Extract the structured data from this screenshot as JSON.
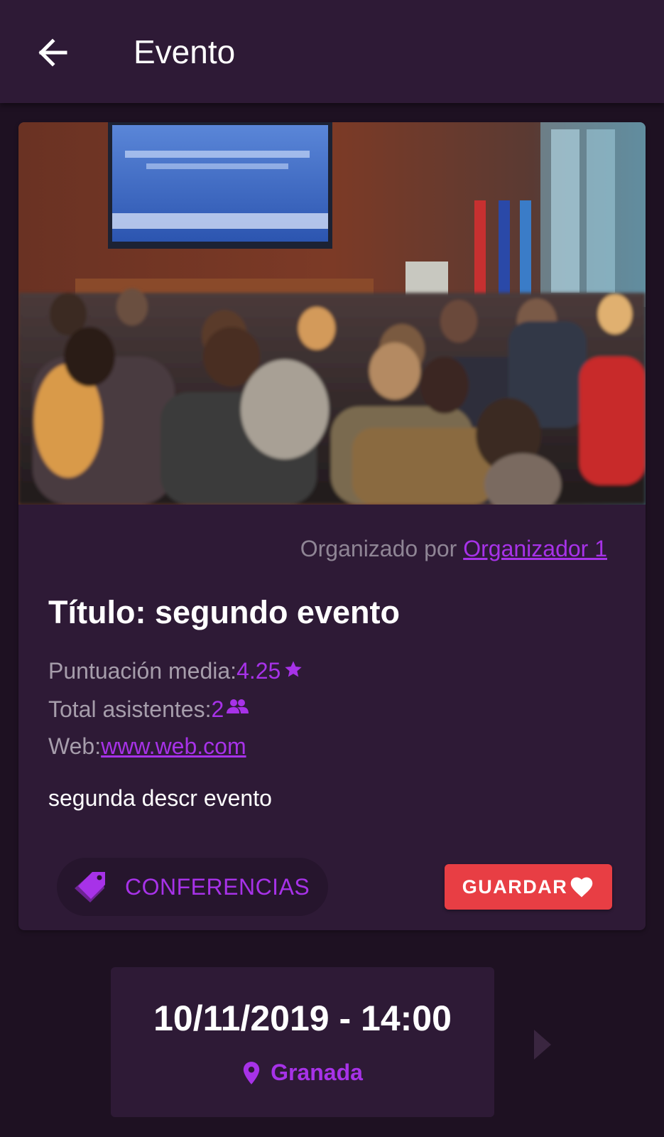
{
  "appbar": {
    "title": "Evento"
  },
  "event": {
    "organizer_prefix": "Organizado por ",
    "organizer_name": "Organizador 1",
    "title": "Título: segundo evento",
    "rating_label": "Puntuación media: ",
    "rating_value": "4.25",
    "attendees_label": "Total asistentes: ",
    "attendees_value": "2",
    "web_label": "Web: ",
    "web_value": "www.web.com",
    "description": "segunda descr evento",
    "category": "CONFERENCIAS",
    "save_label": "GUARDAR"
  },
  "schedule": {
    "datetime": "10/11/2019 - 14:00",
    "location": "Granada"
  },
  "icons": {
    "back": "arrow-left-icon",
    "rating": "star-icon",
    "attendees": "people-icon",
    "category": "tags-icon",
    "save": "heart-icon",
    "location": "map-pin-icon",
    "next": "chevron-right-icon"
  },
  "colors": {
    "background": "#1e1122",
    "surface": "#2e1a36",
    "accent": "#a732e8",
    "save_button": "#e83e44",
    "muted_text": "#a69dab"
  }
}
